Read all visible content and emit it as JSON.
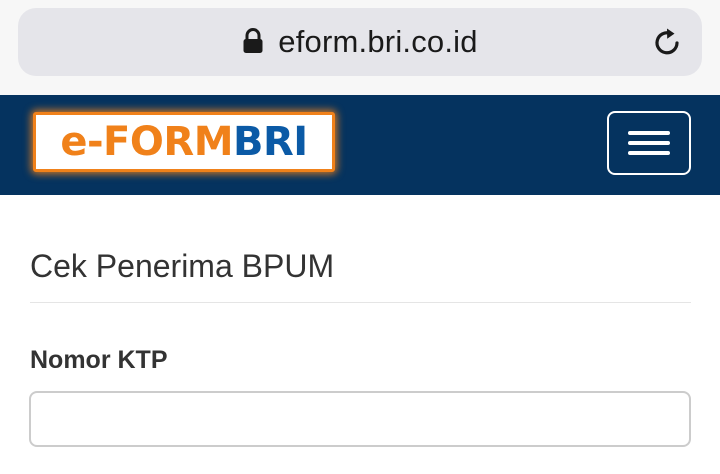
{
  "browser": {
    "url": "eform.bri.co.id",
    "lock_icon": "lock-icon",
    "reload_icon": "reload-icon"
  },
  "navbar": {
    "logo": {
      "part1": "e-FORM",
      "part2": "BRI",
      "colors": {
        "orange": "#f0811a",
        "blue": "#0b5aa6"
      }
    },
    "menu_icon": "hamburger-menu-icon",
    "background": "#05335f"
  },
  "page": {
    "title": "Cek Penerima BPUM"
  },
  "form": {
    "ktp_label": "Nomor KTP",
    "ktp_value": "",
    "ktp_placeholder": ""
  }
}
